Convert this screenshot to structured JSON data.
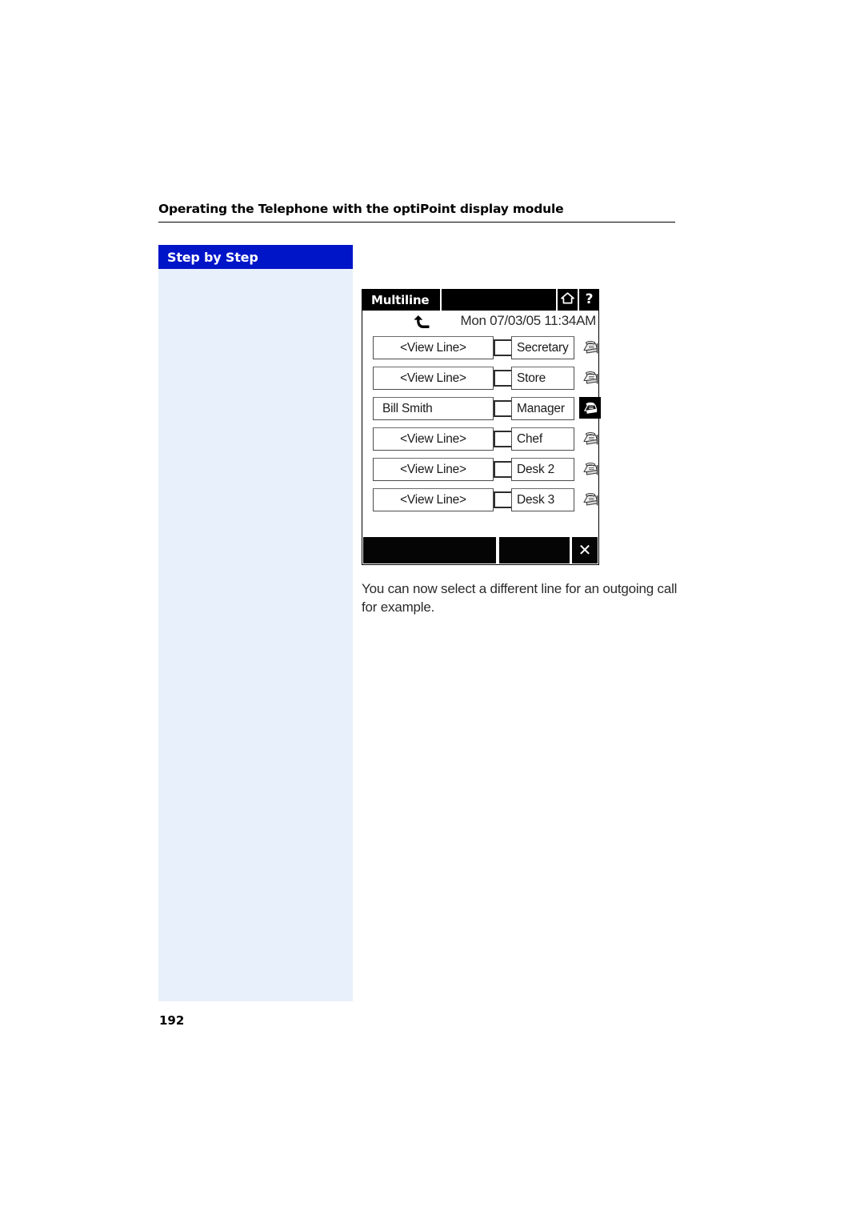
{
  "document": {
    "running_header": "Operating the Telephone with the optiPoint display module",
    "page_number": "192"
  },
  "sidebar": {
    "header_label": "Step by Step"
  },
  "display_module": {
    "titlebar": {
      "tab_label": "Multiline",
      "home_icon": "home-icon",
      "help_label": "?"
    },
    "status": {
      "arrow_icon": "curved-down-arrow-icon",
      "datetime": "Mon 07/03/05 11:34AM"
    },
    "rows": [
      {
        "name": "<View Line>",
        "label": "Secretary",
        "icon": "desk-phone-icon",
        "selected": false
      },
      {
        "name": "<View Line>",
        "label": "Store",
        "icon": "desk-phone-icon",
        "selected": false
      },
      {
        "name": "Bill Smith",
        "label": "Manager",
        "icon": "desk-phone-icon",
        "selected": true
      },
      {
        "name": "<View Line>",
        "label": "Chef",
        "icon": "desk-phone-icon",
        "selected": false
      },
      {
        "name": "<View Line>",
        "label": "Desk 2",
        "icon": "desk-phone-icon",
        "selected": false
      },
      {
        "name": "<View Line>",
        "label": "Desk 3",
        "icon": "desk-phone-icon",
        "selected": false
      }
    ],
    "softkeys": {
      "key_one_label": "",
      "key_two_label": "",
      "exit_label": "✕"
    }
  },
  "body": {
    "paragraph": "You can now select a different line for an outgoing call for example."
  },
  "colors": {
    "sidebar_header": "#0014c8",
    "sidebar_body": "#e8f0fb",
    "device_black": "#000000",
    "text": "#2b2b2b"
  }
}
